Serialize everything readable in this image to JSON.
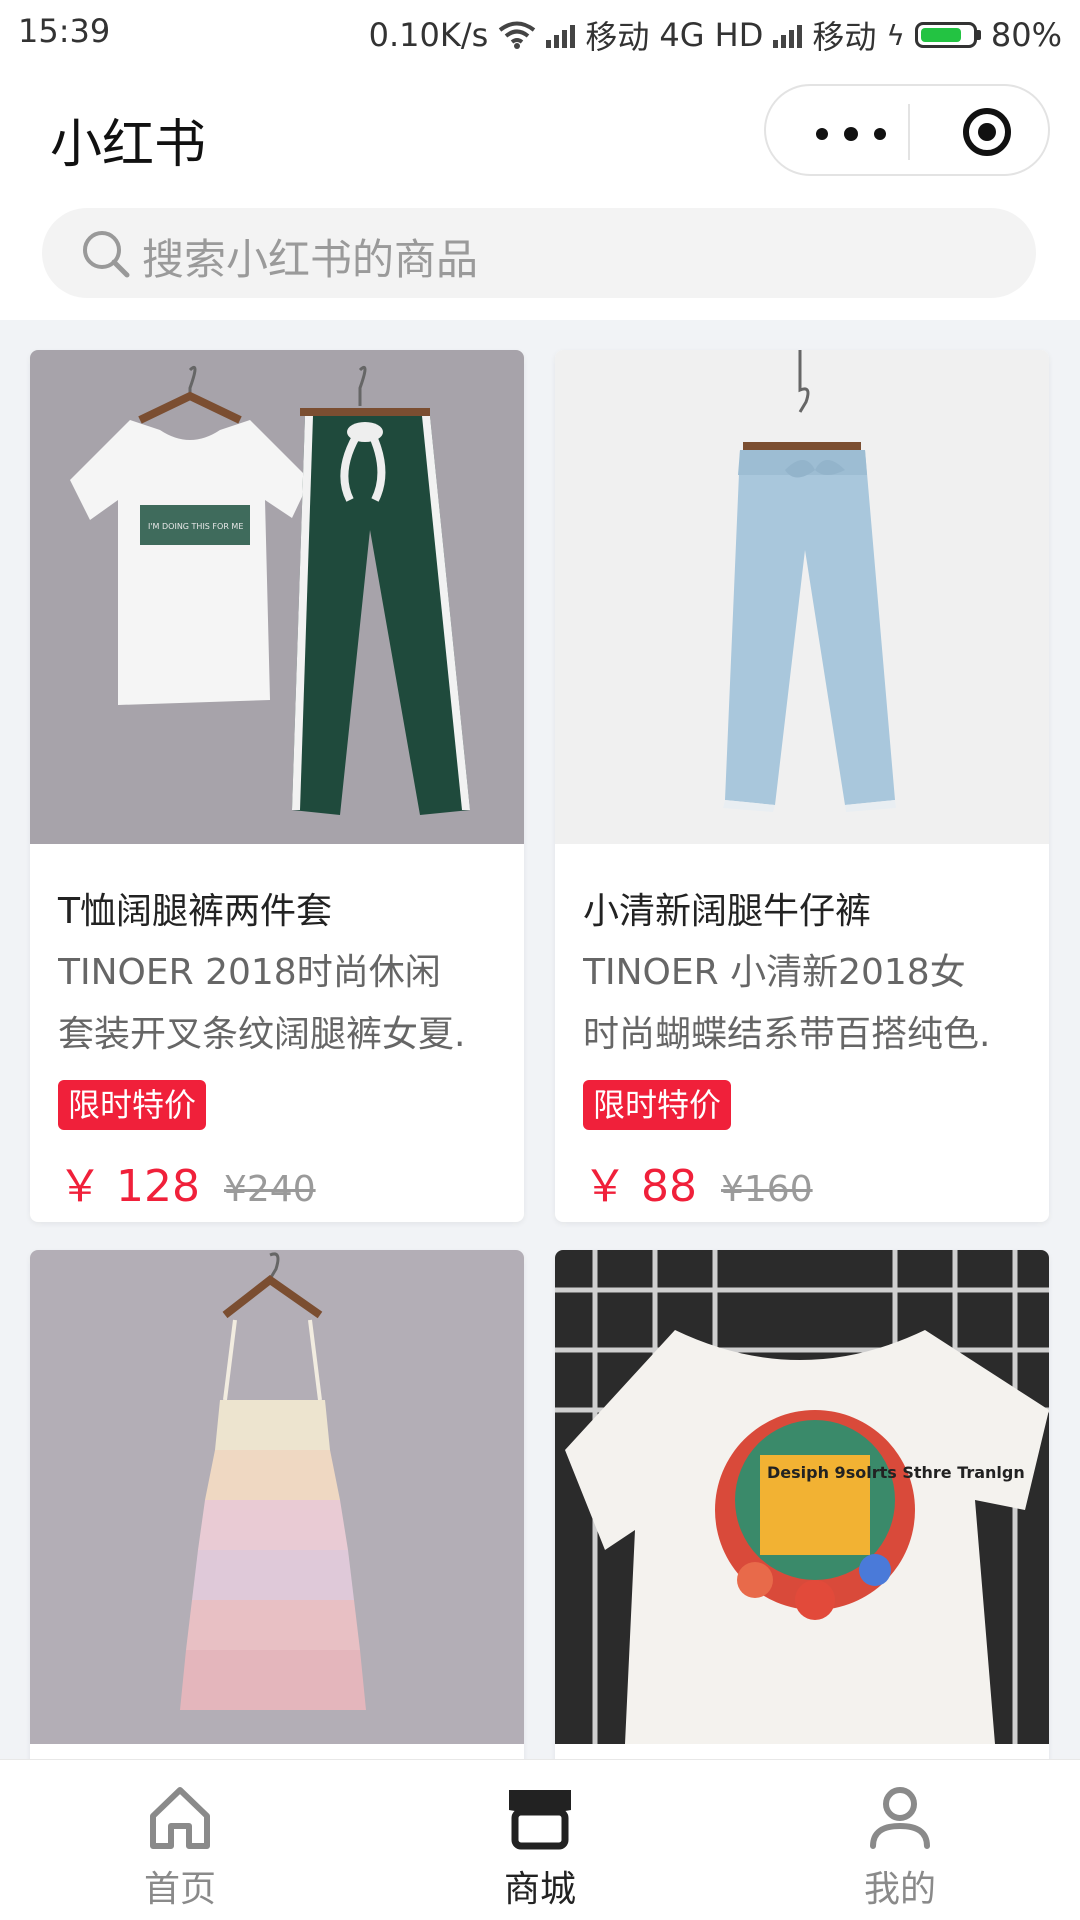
{
  "status_bar": {
    "time": "15:39",
    "speed": "0.10K/s",
    "carrier1": "移动",
    "network": "4G HD",
    "carrier2": "移动",
    "battery": "80%",
    "battery_level": 0.8,
    "battery_color": "#23c342"
  },
  "header": {
    "title": "小红书",
    "menu_icon": "more-dots-icon",
    "close_icon": "target-circle-icon"
  },
  "search": {
    "placeholder": "搜索小红书的商品",
    "icon": "search-icon"
  },
  "products": [
    {
      "name": "T恤阔腿裤两件套",
      "desc_line1": "TINOER 2018时尚休闲",
      "desc_line2": "套装开叉条纹阔腿裤女夏.",
      "tag": "限时特价",
      "currency": "￥",
      "price": "128",
      "old_price": "¥240",
      "image": "tshirt-and-wide-leg-pants-photo"
    },
    {
      "name": "小清新阔腿牛仔裤",
      "desc_line1": "TINOER 小清新2018女",
      "desc_line2": "时尚蝴蝶结系带百搭纯色.",
      "tag": "限时特价",
      "currency": "￥",
      "price": "88",
      "old_price": "¥160",
      "image": "light-blue-jeans-photo"
    },
    {
      "image": "pastel-layered-dress-photo"
    },
    {
      "image": "printed-white-tshirt-photo",
      "print_text": "Desiph 9solrts Sthre Tranlgn"
    }
  ],
  "tabbar": {
    "items": [
      {
        "label": "首页",
        "icon": "home-icon"
      },
      {
        "label": "商城",
        "icon": "shop-icon",
        "active": true
      },
      {
        "label": "我的",
        "icon": "user-icon"
      }
    ]
  },
  "colors": {
    "accent_red": "#f0203a",
    "page_bg": "#f1f3f6"
  }
}
